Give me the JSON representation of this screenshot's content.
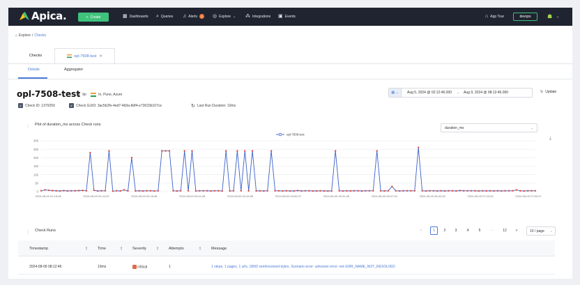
{
  "nav": {
    "brand": "Apica.",
    "create": "Create",
    "items": [
      "Dashboards",
      "Queries",
      "Alerts",
      "Explore",
      "Integrations",
      "Events"
    ],
    "alerts_badge": "2",
    "app_tour": "App Tour",
    "workspace": "devops"
  },
  "breadcrumb": {
    "root": "Explore",
    "current": "Checks"
  },
  "tabs": {
    "checks": "Checks",
    "active": "opl-7508-test"
  },
  "subtabs": {
    "details": "Details",
    "aggregator": "Aggregator"
  },
  "check": {
    "name": "opl-7508-test",
    "type": "fpr",
    "location": "In, Pune, Azure",
    "check_id": "Check ID: 1379259",
    "guid": "Check GUID: 3ac5b2fe-4ed7-4b9a-8df4-e73633b107ce",
    "last_run": "Last Run Duration: 10ms"
  },
  "date_range": {
    "from": "Aug 5, 2024 @ 02:12:46.000",
    "arrow": "→",
    "to": "Aug 9, 2024 @ 08:12:46.000",
    "update": "Update"
  },
  "plot": {
    "title": "Plot of duration_ms across Check runs",
    "metric": "duration_ms"
  },
  "chart_data": {
    "type": "line",
    "series": [
      {
        "name": "opl-7508-test",
        "values": [
          5,
          10,
          8,
          6,
          5,
          4,
          6,
          4,
          5,
          5,
          6,
          7,
          5,
          230,
          8,
          4,
          5,
          5,
          240,
          3,
          5,
          4,
          10,
          4,
          200,
          4,
          5,
          4,
          5,
          5,
          4,
          5,
          240,
          240,
          240,
          5,
          4,
          5,
          240,
          5,
          240,
          4,
          5,
          5,
          5,
          4,
          5,
          5,
          4,
          240,
          4,
          5,
          240,
          5,
          240,
          5,
          240,
          4,
          5,
          4,
          5,
          240,
          5,
          5,
          4,
          5,
          4,
          4,
          6,
          4,
          5,
          5,
          4,
          4,
          5,
          4,
          4,
          4,
          240,
          5,
          4,
          5,
          4,
          5,
          5,
          4,
          5,
          5,
          5,
          240,
          5,
          4,
          5,
          30,
          5,
          4,
          5,
          5,
          5,
          5,
          260,
          5,
          4,
          5,
          5,
          4,
          5,
          4,
          5,
          5,
          4,
          6,
          5,
          5,
          5,
          5,
          4,
          5,
          4,
          5,
          4,
          5,
          4,
          5,
          5,
          5,
          10,
          5,
          4,
          5,
          5,
          5
        ]
      }
    ],
    "y_ticks": [
      "300",
      "250",
      "200",
      "150",
      "100",
      "50",
      "0"
    ],
    "ylim": [
      0,
      300
    ],
    "x_ticks": [
      "2024-08-09 01:18:48",
      "2024-08-09 02:44:25",
      "2024-08-09 03:18:48",
      "2024-08-09 03:44:38",
      "2024-08-09 04:15:56",
      "2024-08-09 04:55:47",
      "2024-08-09 05:31:48",
      "2024-08-09 06:07:49",
      "2024-08-09 06:42:45",
      "2024-08-09 07:23:43",
      "2024-08-09 07:50:47"
    ],
    "legend": "top-center",
    "colors": {
      "line": "#3a5fc8",
      "point": "#e0483d",
      "grid": "#e6e8ec"
    }
  },
  "runs": {
    "title": "Check Runs",
    "pages": [
      "1",
      "2",
      "3",
      "4",
      "5",
      "···",
      "12",
      ">"
    ],
    "prev": "<",
    "page_size": "10 / page",
    "columns": [
      "Timestamp",
      "Time",
      "Severity",
      "Attempts",
      "Message"
    ],
    "rows": [
      {
        "timestamp": "2024-08-09 08:12:46",
        "time": "10ms",
        "severity": "critical",
        "attempts": "1",
        "message": "1 steps, 1 pages, 1 urls, 189/0 sent/received bytes. Scenario error: unknown error: net::ERR_NAME_NOT_RESOLVED"
      }
    ]
  }
}
